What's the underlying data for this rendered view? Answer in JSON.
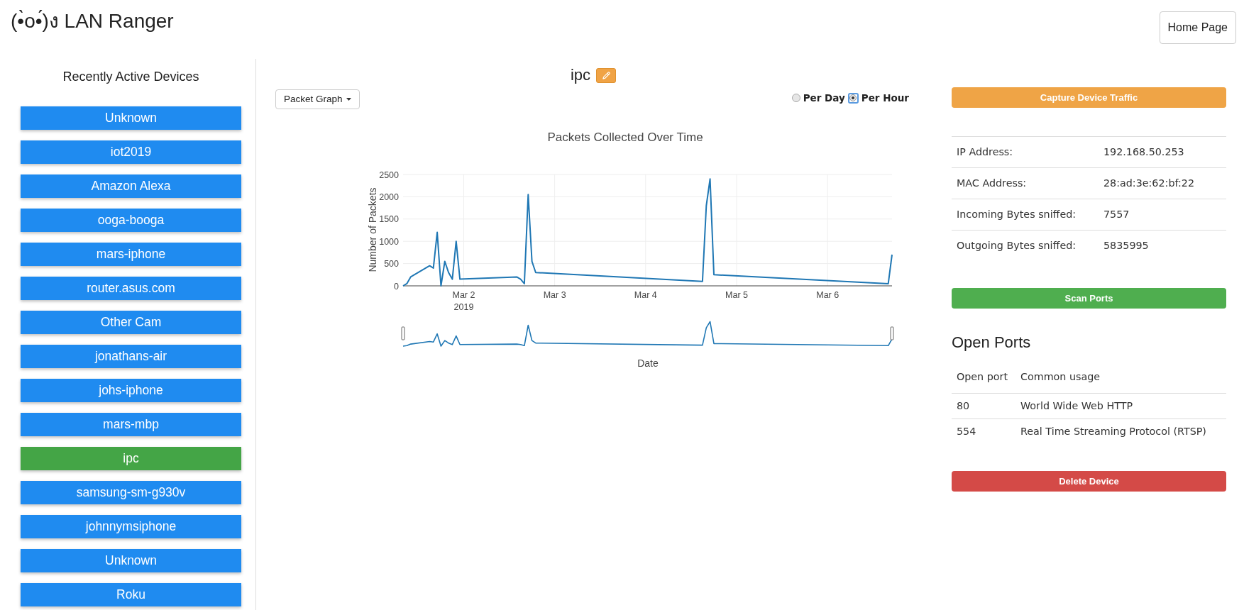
{
  "app": {
    "logo": "(•̀o•́)ง LAN Ranger",
    "home_button": "Home Page"
  },
  "sidebar": {
    "title": "Recently Active Devices",
    "devices": [
      {
        "name": "Unknown",
        "selected": false
      },
      {
        "name": "iot2019",
        "selected": false
      },
      {
        "name": "Amazon Alexa",
        "selected": false
      },
      {
        "name": "ooga-booga",
        "selected": false
      },
      {
        "name": "mars-iphone",
        "selected": false
      },
      {
        "name": "router.asus.com",
        "selected": false
      },
      {
        "name": "Other Cam",
        "selected": false
      },
      {
        "name": "jonathans-air",
        "selected": false
      },
      {
        "name": "johs-iphone",
        "selected": false
      },
      {
        "name": "mars-mbp",
        "selected": false
      },
      {
        "name": "ipc",
        "selected": true
      },
      {
        "name": "samsung-sm-g930v",
        "selected": false
      },
      {
        "name": "johnnymsiphone",
        "selected": false
      },
      {
        "name": "Unknown",
        "selected": false
      },
      {
        "name": "Roku",
        "selected": false
      }
    ]
  },
  "device": {
    "name": "ipc",
    "view_menu": "Packet Graph",
    "period_options": [
      {
        "label": "Per Day",
        "selected": false
      },
      {
        "label": "Per Hour",
        "selected": true
      }
    ],
    "chart": {
      "chart_data": {
        "type": "line",
        "title": "Packets Collected Over Time",
        "xlabel": "Date",
        "ylabel": "Number of Packets",
        "x": [
          "2019-03-01T08:00",
          "2019-03-01T09:00",
          "2019-03-01T10:00",
          "2019-03-01T15:00",
          "2019-03-01T16:00",
          "2019-03-01T17:00",
          "2019-03-01T18:00",
          "2019-03-01T19:00",
          "2019-03-01T20:00",
          "2019-03-01T21:00",
          "2019-03-01T22:00",
          "2019-03-01T23:00",
          "2019-03-02T14:00",
          "2019-03-02T15:00",
          "2019-03-02T16:00",
          "2019-03-02T17:00",
          "2019-03-02T18:00",
          "2019-03-02T19:00",
          "2019-03-04T15:00",
          "2019-03-04T16:00",
          "2019-03-04T17:00",
          "2019-03-04T18:00",
          "2019-03-06T16:00",
          "2019-03-06T17:00"
        ],
        "series": [
          {
            "color": "#1f77b4",
            "values": [
              0,
              50,
              200,
              450,
              400,
              1200,
              0,
              550,
              300,
              150,
              1000,
              150,
              200,
              150,
              50,
              2050,
              550,
              300,
              100,
              1800,
              2400,
              250,
              50,
              700
            ]
          }
        ],
        "xlim": [
          "2019-03-01T08:00",
          "2019-03-06T17:00"
        ],
        "ylim": [
          0,
          2500
        ],
        "xticks": [
          {
            "value": "2019-03-02T00:00",
            "label": "Mar 2\n2019"
          },
          {
            "value": "2019-03-03T00:00",
            "label": "Mar 3"
          },
          {
            "value": "2019-03-04T00:00",
            "label": "Mar 4"
          },
          {
            "value": "2019-03-05T00:00",
            "label": "Mar 5"
          },
          {
            "value": "2019-03-06T00:00",
            "label": "Mar 6"
          }
        ],
        "yticks": [
          0,
          500,
          1000,
          1500,
          2000,
          2500
        ],
        "grid": true
      }
    }
  },
  "details": {
    "capture_button": "Capture Device Traffic",
    "info": [
      {
        "label": "IP Address:",
        "value": "192.168.50.253"
      },
      {
        "label": "MAC Address:",
        "value": "28:ad:3e:62:bf:22"
      },
      {
        "label": "Incoming Bytes sniffed:",
        "value": "7557"
      },
      {
        "label": "Outgoing Bytes sniffed:",
        "value": "5835995"
      }
    ],
    "scan_button": "Scan Ports",
    "open_ports": {
      "title": "Open Ports",
      "columns": [
        "Open port",
        "Common usage"
      ],
      "rows": [
        [
          "80",
          "World Wide Web HTTP"
        ],
        [
          "554",
          "Real Time Streaming Protocol (RTSP)"
        ]
      ]
    },
    "delete_button": "Delete Device"
  }
}
